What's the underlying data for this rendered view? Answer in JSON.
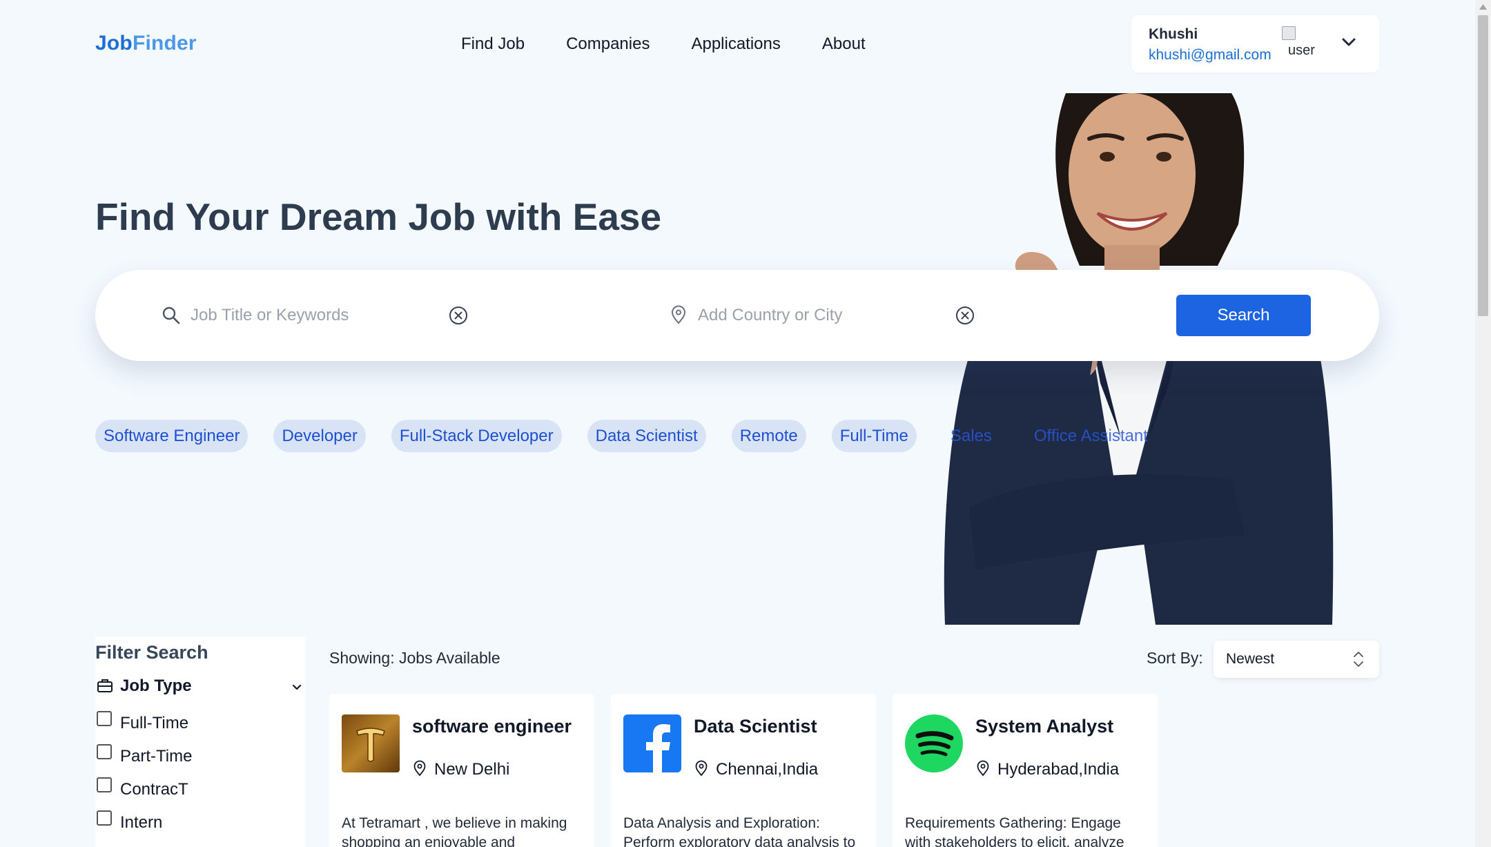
{
  "header": {
    "logo_part1": "Job",
    "logo_part2": "Finder",
    "nav": [
      "Find Job",
      "Companies",
      "Applications",
      "About"
    ],
    "user": {
      "name": "Khushi",
      "email": "khushi@gmail.com",
      "avatar_alt": "user"
    }
  },
  "hero": {
    "title": "Find Your Dream Job with Ease"
  },
  "search": {
    "keyword_placeholder": "Job Title or Keywords",
    "location_placeholder": "Add Country or City",
    "button_label": "Search"
  },
  "tags": [
    "Software Engineer",
    "Developer",
    "Full-Stack Developer",
    "Data Scientist",
    "Remote",
    "Full-Time",
    "Sales",
    "Office Assistant"
  ],
  "filters": {
    "title": "Filter Search",
    "section_label": "Job Type",
    "options": [
      "Full-Time",
      "Part-Time",
      "ContracT",
      "Intern"
    ]
  },
  "results": {
    "showing_text": "Showing: Jobs Available",
    "sort_label": "Sort By:",
    "sort_value": "Newest",
    "jobs": [
      {
        "title": "software engineer",
        "location": "New Delhi",
        "description": "At Tetramart , we believe in making shopping an enjoyable and",
        "logo_icon": "tetramart-logo"
      },
      {
        "title": "Data Scientist",
        "location": "Chennai,India",
        "description": "Data Analysis and Exploration: Perform exploratory data analysis to",
        "logo_icon": "facebook-logo"
      },
      {
        "title": "System Analyst",
        "location": "Hyderabad,India",
        "description": "Requirements Gathering: Engage with stakeholders to elicit, analyze",
        "logo_icon": "spotify-logo"
      }
    ]
  },
  "colors": {
    "brand": "#1d6fd8",
    "primary_button": "#1d64e2",
    "tag_bg": "#d8e4f5",
    "tag_text": "#1d4fd0",
    "page_bg": "#f4f9fe"
  }
}
